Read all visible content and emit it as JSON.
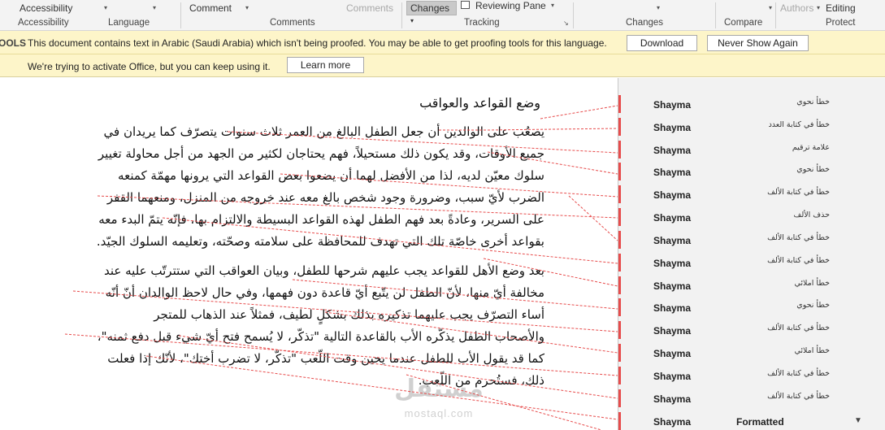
{
  "ribbon": {
    "accessibility_btn": "Accessibility",
    "comment_btn": "Comment",
    "comments_dim": "Comments",
    "changes_btn": "Changes",
    "reviewing_pane": "Reviewing Pane",
    "authors_dim": "Authors",
    "editing_btn": "Editing",
    "groups": {
      "accessibility": "Accessibility",
      "language": "Language",
      "comments": "Comments",
      "tracking": "Tracking",
      "changes": "Changes",
      "compare": "Compare",
      "protect": "Protect"
    }
  },
  "proofing_bar": {
    "prefix": "OOLS",
    "message": "This document contains text in Arabic (Saudi Arabia) which isn't being proofed. You may be able to get proofing tools for this language.",
    "download_btn": "Download",
    "never_show_btn": "Never Show Again"
  },
  "activation_bar": {
    "message": "We're trying to activate Office, but you can keep using it.",
    "learn_more_btn": "Learn more"
  },
  "document": {
    "title": "وضع القواعد والعواقب",
    "lines": [
      "يصعُب على الوالدين أن جعل الطفل البالغ من العمر ثلاث سنوات يتصرّف كما يريدان في",
      "جميع الأوقات، وقد يكون ذلك مستحيلاً، فهم يحتاجان لكثير من الجهد من أجل محاولة تغيير",
      "سلوك معيّن لديه، لذا من الأفضل لهما أن يضعوا بعض القواعد التي يرونها مهمّة كمنعه",
      "الضرب لأيّ سبب، وضرورة وجود شخص بالغ معه عند خروجه من المنزل، ومنعهما القفز",
      "على السرير، وعادةً بعد فهم الطفل لهذه القواعد البسيطة والالتزام بها، فإنّه يتمّ البدء معه",
      "بقواعد أخرى خاصّة تلك التي تهدف للمحافظة على سلامته وصحّته، وتعليمه السلوك الجيّد.",
      "بعد وضع الأهل للقواعد يجب عليهم شرحها للطفل، وبيان العواقب التي ستترتّب عليه عند",
      "مخالفة أيّ منها، لأنّ الطفل لن يتّبع أيّ قاعدة دون فهمها، وفي حال لاحظ الوالدان أنّ أنّه",
      "أساء التصرّف يجب عليهما تذكيره بذلك بشكلٍ لطيف، فمثلاً عند الذهاب للمتجر",
      "والأصحاب الطفل يذكّره الأب بالقاعدة التالية \"تذكّر، لا يُسمح فتح أيّ شيء قبل دفع ثمنه\"،",
      "كما قد يقول الأب للطفل عندما يحين وقت اللّعب \"تذكّر، لا تضرب أختك\"، لأنّك إذا فعلت",
      "ذلك، فستُحرم من اللّعب."
    ]
  },
  "watermark": {
    "arabic": "مستقل",
    "latin": "mostaql.com"
  },
  "markup_pane": {
    "comments": [
      {
        "author": "Shayma",
        "text": "خطأ نحوي"
      },
      {
        "author": "Shayma",
        "text": "خطأ في كتابة العدد"
      },
      {
        "author": "Shayma",
        "text": "علامة ترقيم"
      },
      {
        "author": "Shayma",
        "text": "خطأ نحوي"
      },
      {
        "author": "Shayma",
        "text": "خطأ في كتابة الألف"
      },
      {
        "author": "Shayma",
        "text": "حذف الألف"
      },
      {
        "author": "Shayma",
        "text": "خطأ في كتابة الألف"
      },
      {
        "author": "Shayma",
        "text": "خطأ في كتابة الألف"
      },
      {
        "author": "Shayma",
        "text": "خطأ املائي"
      },
      {
        "author": "Shayma",
        "text": "خطأ نحوي"
      },
      {
        "author": "Shayma",
        "text": "خطأ في كتابة الألف"
      },
      {
        "author": "Shayma",
        "text": "خطأ املائي"
      },
      {
        "author": "Shayma",
        "text": "خطأ في كتابة الألف"
      },
      {
        "author": "Shayma",
        "text": "خطأ في كتابة الألف"
      }
    ],
    "last": {
      "author": "Shayma",
      "label": "Formatted"
    }
  },
  "colors": {
    "revision_red": "#e74c4c",
    "message_bar": "#fdf5c9",
    "ribbon_bg": "#f3f3f3"
  }
}
